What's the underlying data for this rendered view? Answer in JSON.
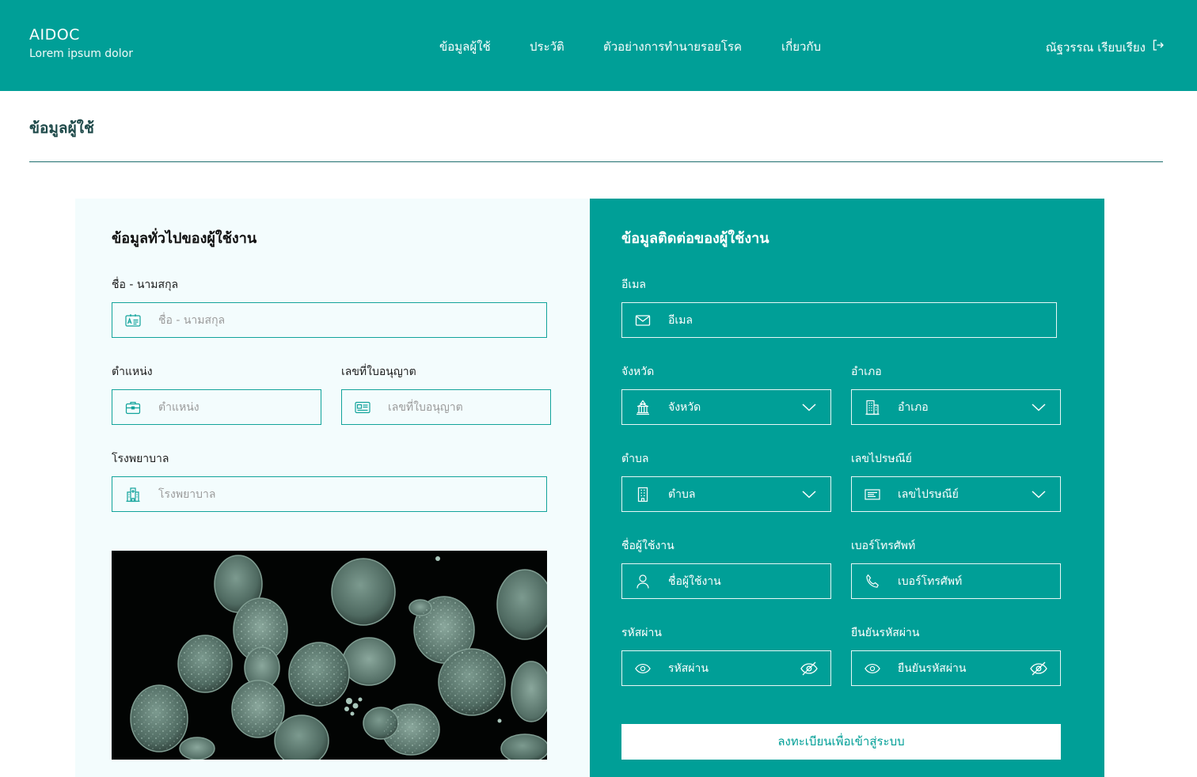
{
  "app": {
    "title": "AIDOC",
    "subtitle": "Lorem ipsum dolor"
  },
  "nav": {
    "items": [
      {
        "label": "ข้อมูลผู้ใช้"
      },
      {
        "label": "ประวัติ"
      },
      {
        "label": "ตัวอย่างการทำนายรอยโรค"
      },
      {
        "label": "เกี่ยวกับ"
      }
    ]
  },
  "user": {
    "name": "ณัฐวรรณ เรียบเรียง",
    "logout_icon": "logout-icon"
  },
  "page": {
    "title": "ข้อมูลผู้ใช้"
  },
  "general": {
    "title": "ข้อมูลทั่วไปของผู้ใช้งาน",
    "fullname": {
      "label": "ชื่อ - นามสกุล",
      "placeholder": "ชื่อ - นามสกุล",
      "icon": "id-card-icon"
    },
    "position": {
      "label": "ตำแหน่ง",
      "placeholder": "ตำแหน่ง",
      "icon": "briefcase-icon"
    },
    "license": {
      "label": "เลขที่ใบอนุญาต",
      "placeholder": "เลขที่ใบอนุญาต",
      "icon": "license-card-icon"
    },
    "hospital": {
      "label": "โรงพยาบาล",
      "placeholder": "โรงพยาบาล",
      "icon": "hospital-icon"
    },
    "image": "cell-microscopy-image"
  },
  "contact": {
    "title": "ข้อมูลติดต่อของผู้ใช้งาน",
    "email": {
      "label": "อีเมล",
      "placeholder": "อีเมล",
      "icon": "mail-icon"
    },
    "province": {
      "label": "จังหวัด",
      "placeholder": "จังหวัด",
      "icon": "landmark-icon"
    },
    "district": {
      "label": "อำเภอ",
      "placeholder": "อำเภอ",
      "icon": "buildings-icon"
    },
    "subdistrict": {
      "label": "ตำบล",
      "placeholder": "ตำบล",
      "icon": "building-icon"
    },
    "postcode": {
      "label": "เลขไปรษณีย์",
      "placeholder": "เลขไปรษณีย์",
      "icon": "postcode-icon"
    },
    "username": {
      "label": "ชื่อผู้ใช้งาน",
      "placeholder": "ชื่อผู้ใช้งาน",
      "icon": "user-icon"
    },
    "phone": {
      "label": "เบอร์โทรศัพท์",
      "placeholder": "เบอร์โทรศัพท์",
      "icon": "phone-icon"
    },
    "password": {
      "label": "รหัสผ่าน",
      "placeholder": "รหัสผ่าน",
      "icon": "eye-icon"
    },
    "confirm_password": {
      "label": "ยืนยันรหัสผ่าน",
      "placeholder": "ยืนยันรหัสผ่าน",
      "icon": "eye-icon"
    },
    "submit_label": "ลงทะเบียนเพื่อเข้าสู่ระบบ"
  },
  "colors": {
    "primary": "#009f97",
    "heading": "#1f4a4a",
    "panel_light": "#f3fcfd"
  }
}
